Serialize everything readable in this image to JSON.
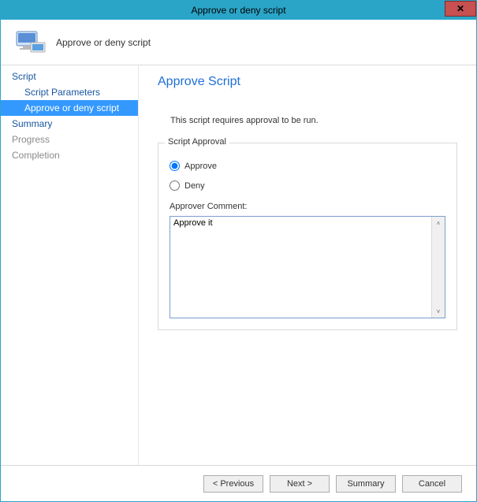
{
  "titlebar": {
    "text": "Approve or deny script"
  },
  "header": {
    "title": "Approve or deny script"
  },
  "sidebar": {
    "items": [
      {
        "label": "Script"
      },
      {
        "label": "Script Parameters"
      },
      {
        "label": "Approve or deny script"
      },
      {
        "label": "Summary"
      },
      {
        "label": "Progress"
      },
      {
        "label": "Completion"
      }
    ]
  },
  "content": {
    "heading": "Approve Script",
    "subtext": "This script requires approval to be run.",
    "group_legend": "Script Approval",
    "radio_approve": "Approve",
    "radio_deny": "Deny",
    "comment_label": "Approver Comment:",
    "comment_value": "Approve it"
  },
  "footer": {
    "previous": "< Previous",
    "next": "Next >",
    "summary": "Summary",
    "cancel": "Cancel"
  }
}
